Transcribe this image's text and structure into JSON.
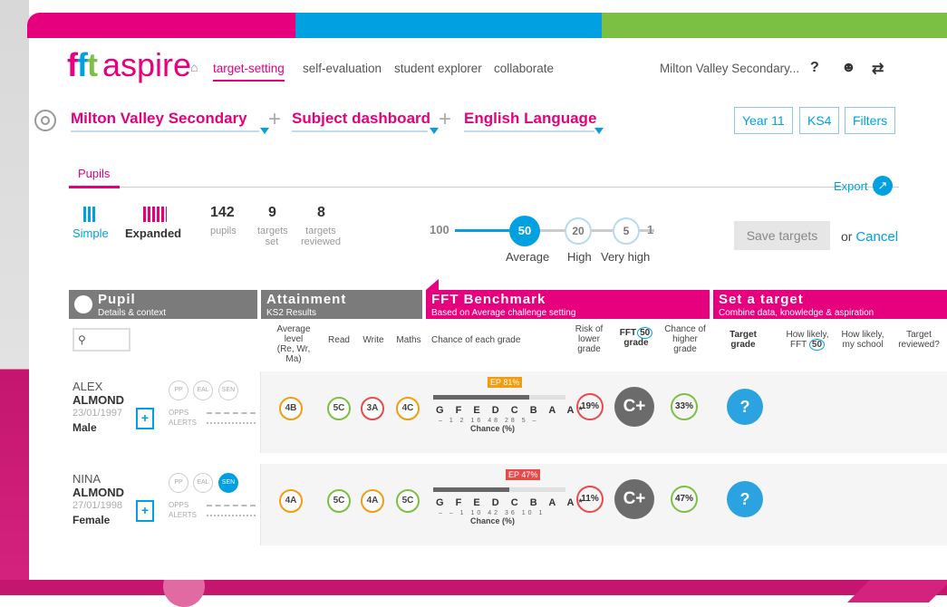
{
  "app": {
    "logo_f": "f",
    "logo_f2": "f",
    "logo_t": "t",
    "logo_name": "aspire"
  },
  "nav": {
    "items": [
      "target-setting",
      "self-evaluation",
      "student explorer",
      "collaborate"
    ],
    "school_short": "Milton Valley Secondary...",
    "help": "?",
    "user": "☻",
    "switch": "⇄"
  },
  "breadcrumb": {
    "school": "Milton Valley Secondary",
    "dashboard": "Subject dashboard",
    "subject": "English Language",
    "plus": "+"
  },
  "chips": [
    "Year 11",
    "KS4",
    "Filters"
  ],
  "tabs": {
    "pupils": "Pupils",
    "export": "Export",
    "export_icon": "↗"
  },
  "view": {
    "simple": "Simple",
    "expanded": "Expanded"
  },
  "stats": {
    "pupils_n": "142",
    "pupils_lbl": "pupils",
    "set_n": "9",
    "set_lbl1": "targets",
    "set_lbl2": "set",
    "rev_n": "8",
    "rev_lbl1": "targets",
    "rev_lbl2": "reviewed"
  },
  "slider": {
    "start": "100",
    "v50": "50",
    "v20": "20",
    "v5": "5",
    "end": "1",
    "lbl_avg": "Average",
    "lbl_high": "High",
    "lbl_vhigh": "Very high",
    "selected": "50"
  },
  "actions": {
    "save": "Save targets",
    "or": "or",
    "cancel": "Cancel"
  },
  "headers": {
    "pupil": {
      "title": "Pupil",
      "sub": "Details & context"
    },
    "attainment": {
      "title": "Attainment",
      "sub": "KS2 Results"
    },
    "benchmark": {
      "title": "FFT Benchmark",
      "sub": "Based on Average challenge setting"
    },
    "target": {
      "title": "Set a target",
      "sub": "Combine data, knowledge & aspiration"
    }
  },
  "columns": {
    "avg1": "Average",
    "avg2": "level",
    "avg3": "(Re, Wr, Ma)",
    "read": "Read",
    "write": "Write",
    "maths": "Maths",
    "chance": "Chance of each grade",
    "risk1": "Risk of",
    "risk2": "lower",
    "risk3": "grade",
    "fft1": "FFT",
    "fft50": "50",
    "fft2": "grade",
    "ch1": "Chance of",
    "ch2": "higher",
    "ch3": "grade",
    "tg1": "Target",
    "tg2": "grade",
    "hl1": "How likely,",
    "hl2": "FFT",
    "hl50": "50",
    "hs1": "How likely,",
    "hs2": "my school",
    "tr1": "Target",
    "tr2": "reviewed?"
  },
  "grades": "G F E D C B A A*",
  "chance_lbl": "Chance (%)",
  "rows": [
    {
      "first": "ALEX",
      "last": "ALMOND",
      "dob": "23/01/1997",
      "sex": "Male",
      "pp": "PP",
      "eal": "EAL",
      "sen": "SEN",
      "sen_on": false,
      "opps": "OPPS",
      "alerts": "ALERTS",
      "avg": "4B",
      "read": "5C",
      "write": "3A",
      "maths": "4C",
      "ep": "EP 81%",
      "pcts": "–  1  2  16  48  28  5  –",
      "risk": "19%",
      "fft": "C+",
      "higher": "33%",
      "target": "?"
    },
    {
      "first": "NINA",
      "last": "ALMOND",
      "dob": "27/01/1998",
      "sex": "Female",
      "pp": "PP",
      "eal": "EAL",
      "sen": "SEN",
      "sen_on": true,
      "opps": "OPPS",
      "alerts": "ALERTS",
      "avg": "4A",
      "read": "5C",
      "write": "4A",
      "maths": "5C",
      "ep": "EP 47%",
      "pcts": "–  –  1  10  42  36  10  1",
      "risk": "11%",
      "fft": "C+",
      "higher": "47%",
      "target": "?"
    }
  ],
  "colors": {
    "magenta": "#e6007e",
    "blue": "#00a0e1",
    "green": "#7bc043",
    "orange": "#f39c12",
    "red": "#e84a4a"
  }
}
